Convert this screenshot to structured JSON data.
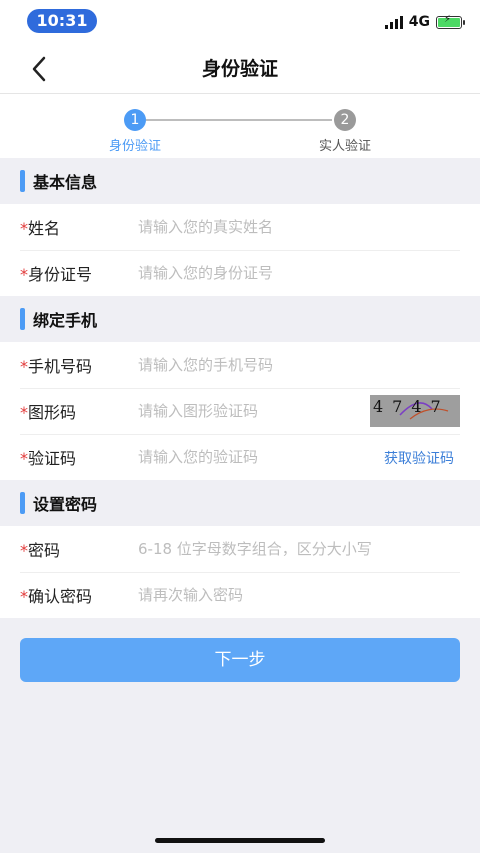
{
  "status_bar": {
    "time": "10:31",
    "network": "4G"
  },
  "nav": {
    "title": "身份验证"
  },
  "steps": [
    {
      "number": "1",
      "label": "身份验证"
    },
    {
      "number": "2",
      "label": "实人验证"
    }
  ],
  "sections": {
    "basic": {
      "title": "基本信息",
      "name": {
        "label": "姓名",
        "placeholder": "请输入您的真实姓名"
      },
      "id_number": {
        "label": "身份证号",
        "placeholder": "请输入您的身份证号"
      }
    },
    "phone": {
      "title": "绑定手机",
      "mobile": {
        "label": "手机号码",
        "placeholder": "请输入您的手机号码"
      },
      "captcha": {
        "label": "图形码",
        "placeholder": "请输入图形验证码",
        "image_text": "4747"
      },
      "sms_code": {
        "label": "验证码",
        "placeholder": "请输入您的验证码",
        "action": "获取验证码"
      }
    },
    "password": {
      "title": "设置密码",
      "password": {
        "label": "密码",
        "placeholder": "6-18 位字母数字组合，区分大小写"
      },
      "confirm": {
        "label": "确认密码",
        "placeholder": "请再次输入密码"
      }
    }
  },
  "required_mark": "*",
  "next_button": "下一步",
  "colors": {
    "accent": "#4c9bf5",
    "button": "#5ea7f7",
    "required": "#e23b3b",
    "time_pill": "#2f6bdc"
  }
}
